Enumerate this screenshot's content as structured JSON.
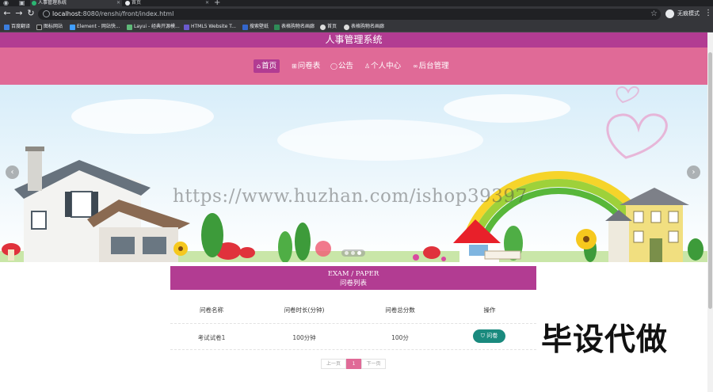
{
  "browser": {
    "tabs": [
      {
        "title": "人事管理系统",
        "active": true
      },
      {
        "title": "首页",
        "active": false
      }
    ],
    "new_tab": "+",
    "url_host": "localhost",
    "url_rest": ":8080/renshi/front/index.html",
    "profile_label": "无痕模式",
    "bookmarks": [
      {
        "label": "百度翻译",
        "color": "#3b7ddd"
      },
      {
        "label": "图标网站",
        "color": "#222222"
      },
      {
        "label": "Element - 网站快...",
        "color": "#409eff"
      },
      {
        "label": "Layui - 经典开源模...",
        "color": "#5fb878"
      },
      {
        "label": "HTML5 Website T...",
        "color": "#6a5acd"
      },
      {
        "label": "搜索壁纸",
        "color": "#3366cc"
      },
      {
        "label": "表格购物名画廊",
        "color": "#2e8b57"
      },
      {
        "label": "首页",
        "color": "#dddddd"
      },
      {
        "label": "表格购物名画廊",
        "color": "#dddddd"
      }
    ]
  },
  "site": {
    "title": "人事管理系统",
    "nav": [
      {
        "glyph": "⌂",
        "label": "首页",
        "active": true
      },
      {
        "glyph": "⊞",
        "label": "问卷表",
        "active": false
      },
      {
        "glyph": "◯",
        "label": "公告",
        "active": false
      },
      {
        "glyph": "♙",
        "label": "个人中心",
        "active": false
      },
      {
        "glyph": "∞",
        "label": "后台管理",
        "active": false
      }
    ],
    "colors": {
      "primary": "#b23c92",
      "nav_bg": "#e06a97",
      "op_button": "#1a8a7e"
    }
  },
  "carousel": {
    "prev": "‹",
    "next": "›",
    "watermark": "https://www.huzhan.com/ishop39397",
    "slide_count": 3
  },
  "exam": {
    "title_en": "EXAM / PAPER",
    "title_cn": "问卷列表",
    "headers": [
      "问卷名称",
      "问卷时长(分钟)",
      "问卷总分数",
      "操作"
    ],
    "rows": [
      {
        "name": "考试试卷1",
        "duration": "100分钟",
        "score": "100分",
        "action": "问卷"
      }
    ],
    "pager": {
      "prev": "上一页",
      "current": "1",
      "next": "下一页"
    }
  },
  "ad_text": "毕设代做"
}
